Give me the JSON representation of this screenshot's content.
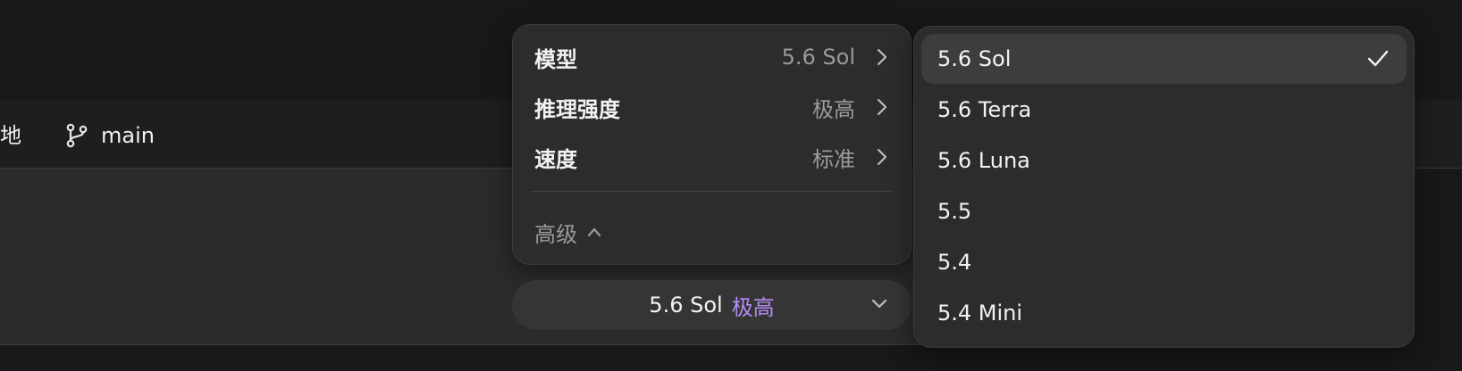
{
  "background": {
    "crumb_partial": "地",
    "branch_label": "main"
  },
  "menu": {
    "rows": [
      {
        "label": "模型",
        "value": "5.6 Sol"
      },
      {
        "label": "推理强度",
        "value": "极高"
      },
      {
        "label": "速度",
        "value": "标准"
      }
    ],
    "advanced_label": "高级"
  },
  "selector": {
    "model": "5.6 Sol",
    "effort": "极高",
    "accent_color": "#b58cf5"
  },
  "dropdown": {
    "options": [
      {
        "label": "5.6 Sol",
        "selected": true
      },
      {
        "label": "5.6 Terra",
        "selected": false
      },
      {
        "label": "5.6 Luna",
        "selected": false
      },
      {
        "label": "5.5",
        "selected": false
      },
      {
        "label": "5.4",
        "selected": false
      },
      {
        "label": "5.4 Mini",
        "selected": false
      }
    ]
  }
}
